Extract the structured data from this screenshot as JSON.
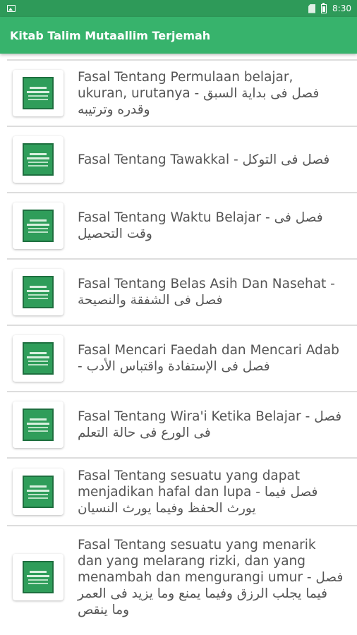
{
  "status_bar": {
    "time": "8:30"
  },
  "app_bar": {
    "title": "Kitab Talim Mutaallim Terjemah"
  },
  "items": [
    {
      "title": "Fasal Tentang Permulaan belajar, ukuran, urutanya - فصل فى بداية السبق وقدره وترتيبه"
    },
    {
      "title": "Fasal Tentang Tawakkal - فصل فى التوكل"
    },
    {
      "title": "Fasal Tentang Waktu Belajar - فصل فى وقت التحصيل"
    },
    {
      "title": "Fasal Tentang Belas Asih Dan Nasehat - فصل فى الشفقة والنصيحة"
    },
    {
      "title": "Fasal Mencari Faedah dan Mencari Adab - فصل فى الإستفادة واقتباس الأدب"
    },
    {
      "title": "Fasal Tentang Wira'i Ketika Belajar - فصل فى الورع فى حالة التعلم"
    },
    {
      "title": "Fasal Tentang sesuatu yang dapat menjadikan hafal dan lupa - فصل فيما يورث الحفظ وفيما يورث النسيان"
    },
    {
      "title": "Fasal Tentang sesuatu yang menarik dan yang melarang rizki, dan yang menambah dan mengurangi umur - فصل فيما يجلب الرزق وفيما يمنع وما يزيد فى العمر وما ينقص"
    }
  ]
}
